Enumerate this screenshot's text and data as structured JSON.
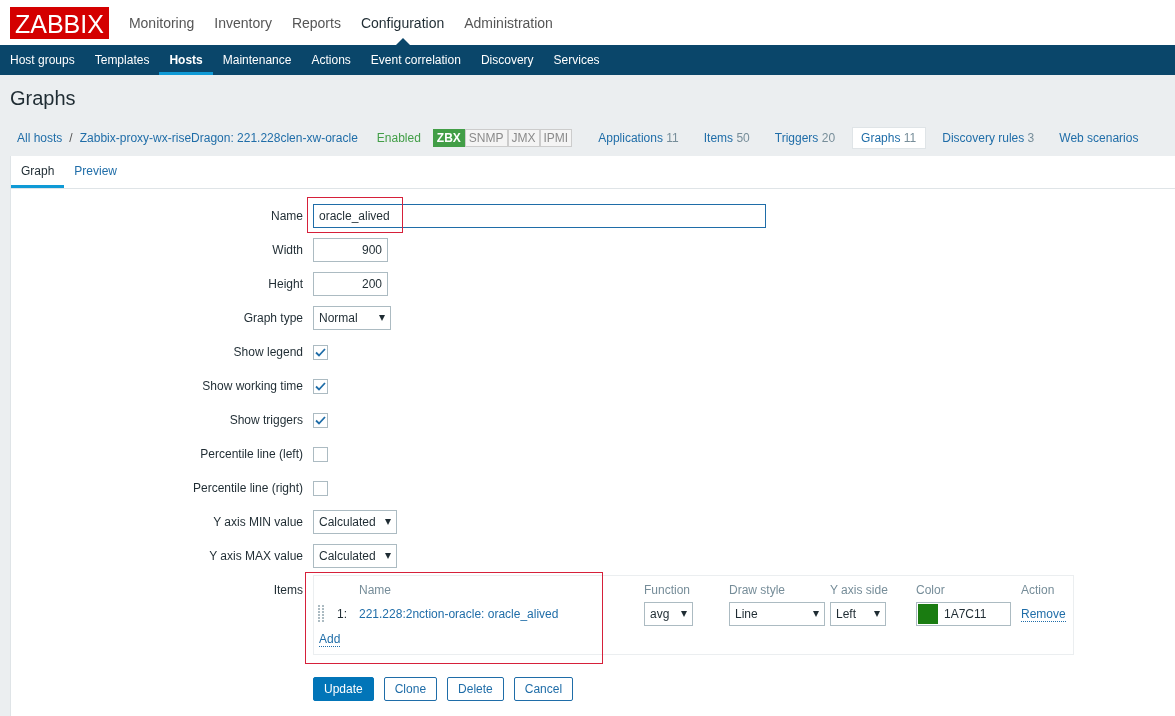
{
  "logo": "ZABBIX",
  "main_menu": [
    {
      "label": "Monitoring",
      "selected": false
    },
    {
      "label": "Inventory",
      "selected": false
    },
    {
      "label": "Reports",
      "selected": false
    },
    {
      "label": "Configuration",
      "selected": true
    },
    {
      "label": "Administration",
      "selected": false
    }
  ],
  "sub_menu": [
    {
      "label": "Host groups",
      "selected": false
    },
    {
      "label": "Templates",
      "selected": false
    },
    {
      "label": "Hosts",
      "selected": true
    },
    {
      "label": "Maintenance",
      "selected": false
    },
    {
      "label": "Actions",
      "selected": false
    },
    {
      "label": "Event correlation",
      "selected": false
    },
    {
      "label": "Discovery",
      "selected": false
    },
    {
      "label": "Services",
      "selected": false
    }
  ],
  "page_title": "Graphs",
  "breadcrumb": {
    "all_hosts": "All hosts",
    "separator": "/",
    "host": "Zabbix-proxy-wx-riseDragon: 221.228clen-xw-oracle",
    "status": "Enabled",
    "availability": [
      {
        "label": "ZBX",
        "on": true
      },
      {
        "label": "SNMP",
        "on": false
      },
      {
        "label": "JMX",
        "on": false
      },
      {
        "label": "IPMI",
        "on": false
      }
    ],
    "links": [
      {
        "label": "Applications",
        "count": "11",
        "selected": false
      },
      {
        "label": "Items",
        "count": "50",
        "selected": false
      },
      {
        "label": "Triggers",
        "count": "20",
        "selected": false
      },
      {
        "label": "Graphs",
        "count": "11",
        "selected": true
      },
      {
        "label": "Discovery rules",
        "count": "3",
        "selected": false
      },
      {
        "label": "Web scenarios",
        "selected": false
      }
    ]
  },
  "tabs": [
    {
      "label": "Graph",
      "selected": true
    },
    {
      "label": "Preview",
      "selected": false
    }
  ],
  "form": {
    "fields": [
      {
        "kind": "text",
        "label": "Name",
        "value": "oracle_alived",
        "highlighted": true
      },
      {
        "kind": "number",
        "label": "Width",
        "value": "900"
      },
      {
        "kind": "number",
        "label": "Height",
        "value": "200"
      },
      {
        "kind": "select",
        "label": "Graph type",
        "value": "Normal"
      },
      {
        "kind": "checkbox",
        "label": "Show legend",
        "checked": true
      },
      {
        "kind": "checkbox",
        "label": "Show working time",
        "checked": true
      },
      {
        "kind": "checkbox",
        "label": "Show triggers",
        "checked": true
      },
      {
        "kind": "checkbox",
        "label": "Percentile line (left)",
        "checked": false
      },
      {
        "kind": "checkbox",
        "label": "Percentile line (right)",
        "checked": false
      },
      {
        "kind": "select",
        "label": "Y axis MIN value",
        "value": "Calculated"
      },
      {
        "kind": "select",
        "label": "Y axis MAX value",
        "value": "Calculated"
      }
    ],
    "items": {
      "label": "Items",
      "highlighted": true,
      "columns": [
        "Name",
        "Function",
        "Draw style",
        "Y axis side",
        "Color",
        "Action"
      ],
      "rows": [
        {
          "index": "1:",
          "name": "221.228:2nction-oracle: oracle_alived",
          "function": "avg",
          "draw_style": "Line",
          "y_axis_side": "Left",
          "color": "#1a7c11",
          "color_code": "1A7C11",
          "action": "Remove"
        }
      ],
      "add": "Add"
    },
    "buttons": [
      {
        "label": "Update",
        "primary": true
      },
      {
        "label": "Clone",
        "primary": false
      },
      {
        "label": "Delete",
        "primary": false
      },
      {
        "label": "Cancel",
        "primary": false
      }
    ]
  }
}
